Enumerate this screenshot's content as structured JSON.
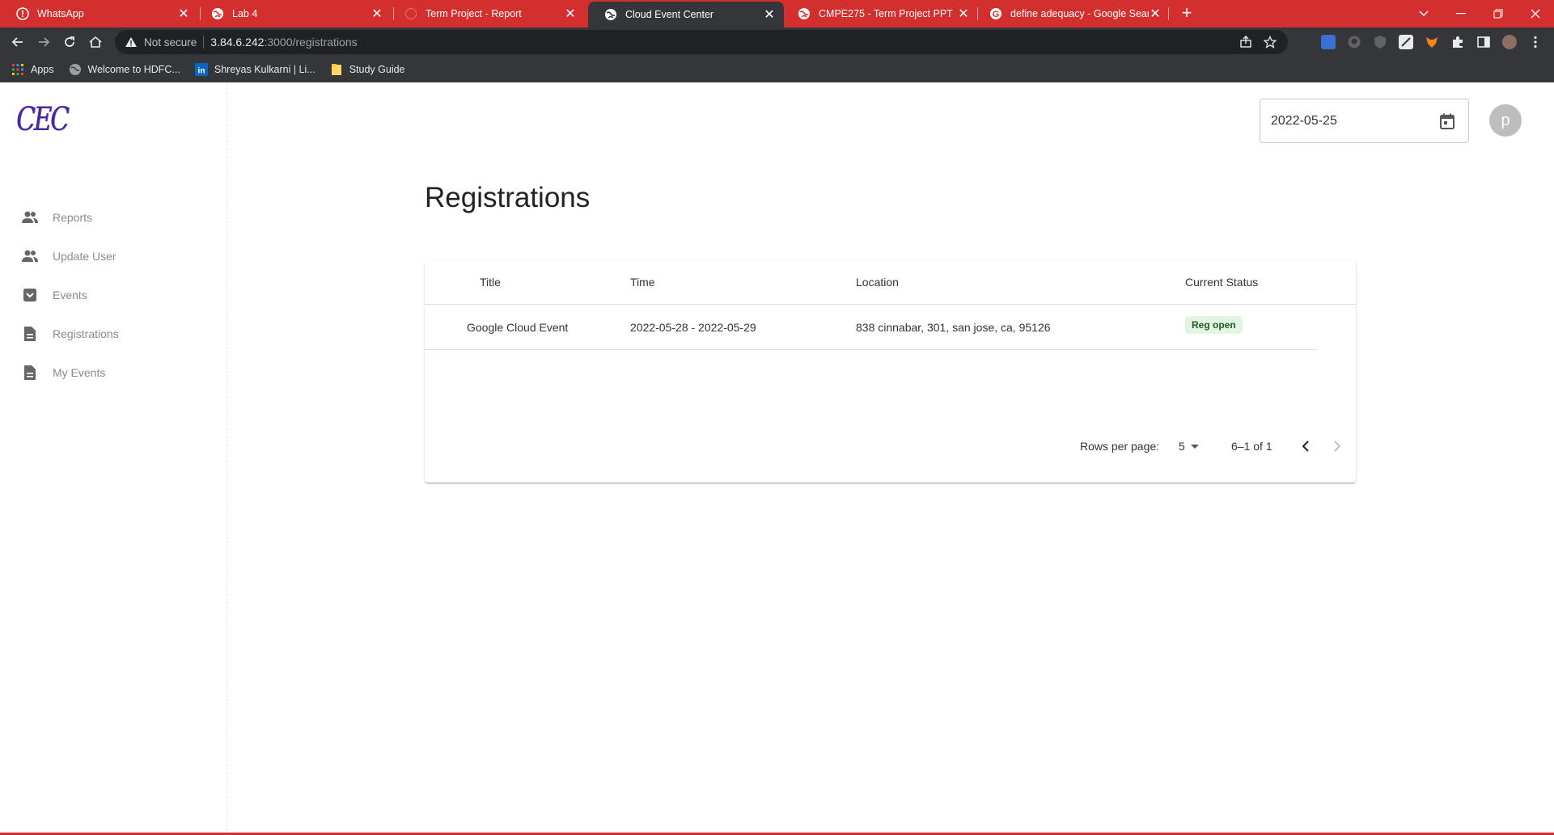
{
  "browser": {
    "tabs": [
      {
        "title": "WhatsApp",
        "icon": "whatsapp-alert-icon",
        "active": false
      },
      {
        "title": "Lab 4",
        "icon": "globe-icon",
        "active": false
      },
      {
        "title": "Term Project - Report",
        "icon": "loading-icon",
        "active": false
      },
      {
        "title": "Cloud Event Center",
        "icon": "globe-icon",
        "active": true
      },
      {
        "title": "CMPE275 - Term Project PPT",
        "icon": "globe-icon",
        "active": false
      },
      {
        "title": "define adequacy - Google Search",
        "icon": "google-icon",
        "active": false
      }
    ],
    "close_glyph": "✕",
    "new_tab_glyph": "+",
    "security_label": "Not secure",
    "url_host": "3.84.6.242",
    "url_path": ":3000/registrations",
    "bookmarks": [
      {
        "label": "Apps",
        "icon": "apps-grid-icon"
      },
      {
        "label": "Welcome to HDFC...",
        "icon": "globe-icon"
      },
      {
        "label": "Shreyas Kulkarni | Li...",
        "icon": "linkedin-icon"
      },
      {
        "label": "Study Guide",
        "icon": "folder-icon"
      }
    ],
    "accent_color": "#d32f2f",
    "toolbar_color": "#35363a"
  },
  "app": {
    "logo_text": "CEC",
    "nav": [
      {
        "label": "Reports",
        "icon": "people-icon"
      },
      {
        "label": "Update User",
        "icon": "people-icon"
      },
      {
        "label": "Events",
        "icon": "inbox-icon"
      },
      {
        "label": "Registrations",
        "icon": "document-icon"
      },
      {
        "label": "My Events",
        "icon": "document-icon"
      }
    ],
    "date_value": "2022-05-25",
    "avatar_initial": "p",
    "page_title": "Registrations",
    "table": {
      "columns": [
        "Title",
        "Time",
        "Location",
        "Current Status"
      ],
      "rows": [
        {
          "title": "Google Cloud Event",
          "time": "2022-05-28 - 2022-05-29",
          "location": "838 cinnabar, 301, san jose, ca, 95126",
          "status": "Reg open",
          "status_color": "#1b5e20",
          "status_bg": "#e3f4e3"
        }
      ]
    },
    "pagination": {
      "rows_per_page_label": "Rows per page:",
      "rows_per_page_value": "5",
      "range_text": "6–1 of 1"
    }
  }
}
